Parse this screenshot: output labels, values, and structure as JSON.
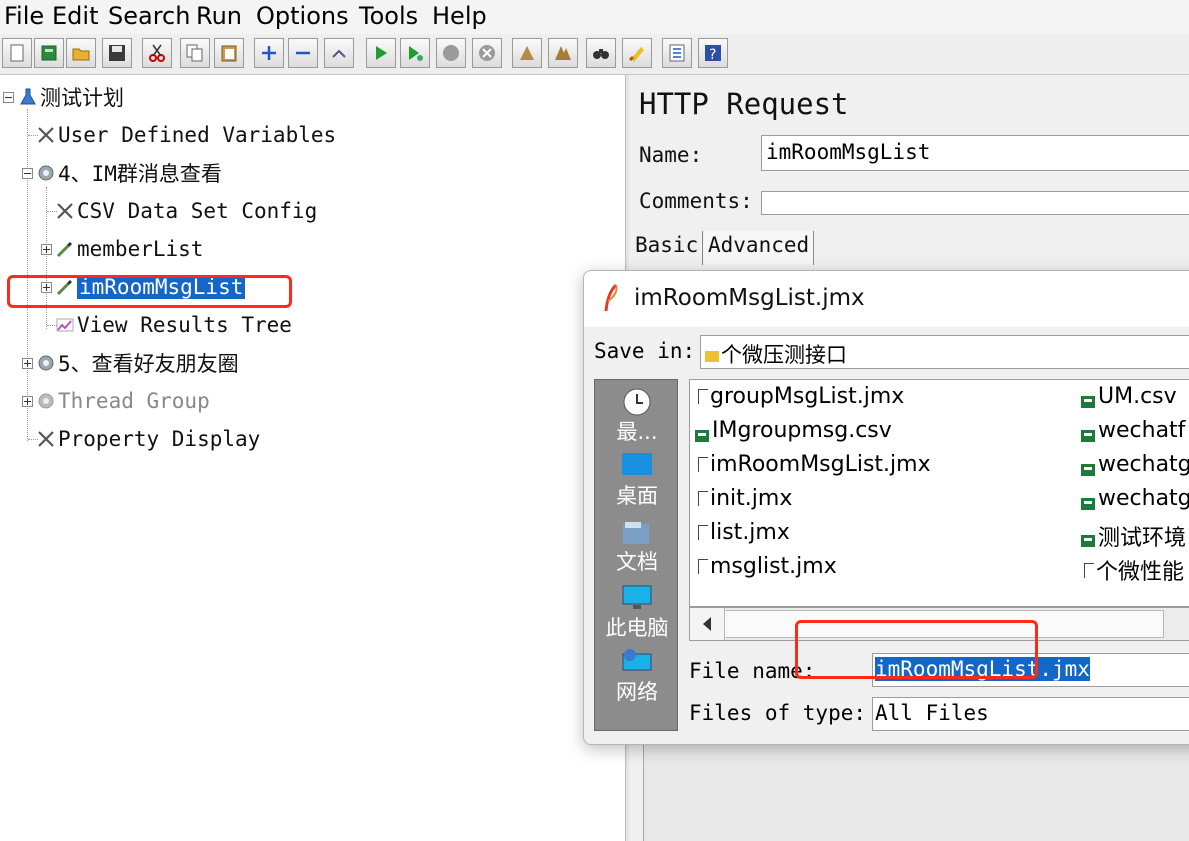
{
  "menu": [
    "File",
    "Edit",
    "Search",
    "Run",
    "Options",
    "Tools",
    "Help"
  ],
  "toolbar_icons": [
    "new-icon",
    "templates-icon",
    "open-icon",
    "save-icon",
    "cut-icon",
    "copy-icon",
    "paste-icon",
    "expand-icon",
    "collapse-icon",
    "toggle-icon",
    "start-icon",
    "start-no-pause-icon",
    "stop-icon",
    "shutdown-icon",
    "clear-icon",
    "clear-all-icon",
    "search-icon",
    "reset-search-icon",
    "function-helper-icon",
    "help-icon"
  ],
  "tree": {
    "root": "测试计划",
    "user_defined_variables": "User Defined Variables",
    "thread_group_4": "4、IM群消息查看",
    "csv_data_set": "CSV Data Set Config",
    "member_list": "memberList",
    "im_room_msg_list": "imRoomMsgList",
    "view_results_tree": "View Results Tree",
    "thread_group_5": "5、查看好友朋友圈",
    "thread_group": "Thread Group",
    "property_display": "Property Display"
  },
  "http_request": {
    "title": "HTTP Request",
    "name_label": "Name:",
    "name_value": "imRoomMsgList",
    "comments_label": "Comments:",
    "tabs": [
      "Basic",
      "Advanced"
    ]
  },
  "dialog": {
    "title": "imRoomMsgList.jmx",
    "save_in_label": "Save in:",
    "save_in_value": "个微压测接口",
    "places": [
      "最...",
      "桌面",
      "文档",
      "此电脑",
      "网络"
    ],
    "files_col1": [
      "groupMsgList.jmx",
      "IMgroupmsg.csv",
      "imRoomMsgList.jmx",
      "init.jmx",
      "list.jmx",
      "msglist.jmx"
    ],
    "files_col2": [
      "UM.csv",
      "wechatf",
      "wechatg",
      "wechatg",
      "测试环境",
      "个微性能"
    ],
    "file_name_label": "File name:",
    "file_name_value": "imRoomMsgList.jmx",
    "files_of_type_label": "Files of type:",
    "files_of_type_value": "All Files"
  },
  "colors": {
    "selection": "#1466c8",
    "highlight_box": "#ff2a1a"
  }
}
